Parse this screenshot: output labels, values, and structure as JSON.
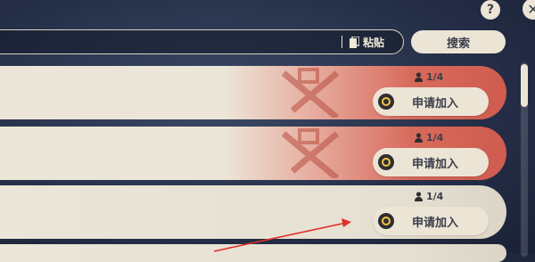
{
  "top": {
    "paste_label": "粘贴",
    "search_label": "搜索",
    "help_label": "?",
    "close_label": "✕"
  },
  "rooms": [
    {
      "players": "1/4",
      "join_label": "申请加入",
      "style": "red"
    },
    {
      "players": "1/4",
      "join_label": "申请加入",
      "style": "red"
    },
    {
      "players": "1/4",
      "join_label": "申请加入",
      "style": "plain"
    }
  ],
  "colors": {
    "accent_red": "#cf5c4e",
    "button_bg": "#ece5d6",
    "text_dark": "#3b3f4b",
    "coin_yellow": "#f2c542",
    "annotation_arrow": "#e0302a"
  },
  "icons": [
    "user-icon",
    "paste-icon",
    "coin-icon",
    "help-icon",
    "close-icon",
    "emblem-icon"
  ]
}
